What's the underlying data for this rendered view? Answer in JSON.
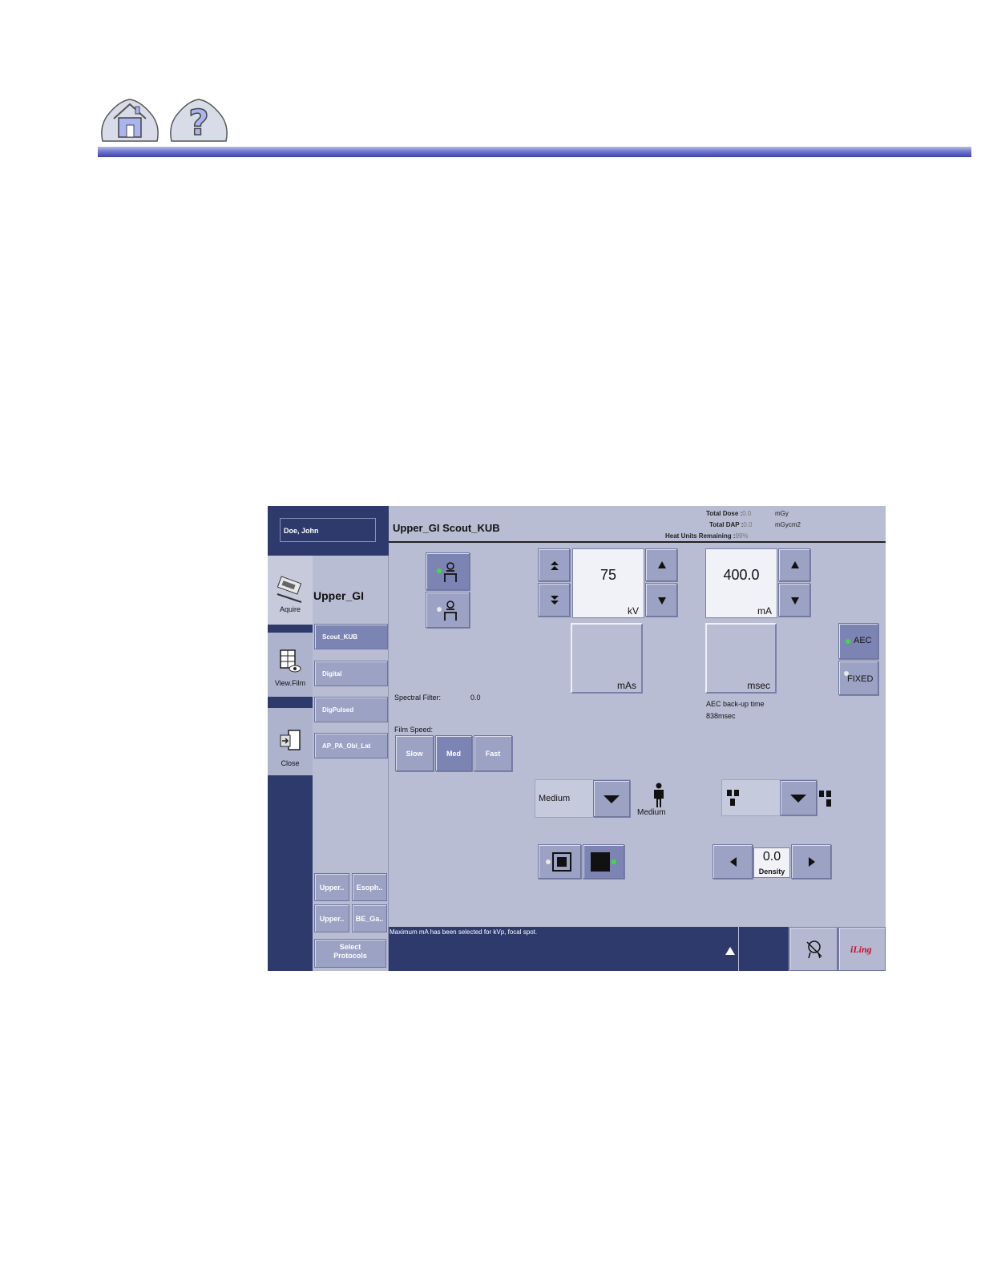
{
  "manual_nav": {
    "home_icon": "home-icon",
    "help_icon": "question-mark-icon"
  },
  "patient": {
    "name": "Doe, John"
  },
  "tabs": [
    {
      "label": "Aquire",
      "icon": "acquire-icon"
    },
    {
      "label": "View.Film",
      "icon": "view-film-icon"
    },
    {
      "label": "Close",
      "icon": "close-door-icon"
    }
  ],
  "protocol_group": "Upper_GI",
  "protocols": [
    "Scout_KUB",
    "Digital",
    "DigPulsed",
    "AP_PA_Obl_Lat"
  ],
  "quick_protocols": [
    "Upper..",
    "Esoph..",
    "Upper..",
    "BE_Ga.."
  ],
  "select_protocols": {
    "line1": "Select",
    "line2": "Protocols"
  },
  "header": {
    "title": "Upper_GI  Scout_KUB"
  },
  "dose": {
    "total_dose_label": "Total Dose :",
    "total_dose_value": "0.0",
    "total_dose_unit": "mGy",
    "total_dap_label": "Total DAP :",
    "total_dap_value": "0.0",
    "total_dap_unit": "mGycm2",
    "heat_label": "Heat Units Remaining :",
    "heat_value": "99%"
  },
  "technique": {
    "kv_value": "75",
    "kv_unit": "kV",
    "ma_value": "400.0",
    "ma_unit": "mA",
    "mas_unit": "mAs",
    "msec_unit": "msec",
    "aec_label": "AEC",
    "fixed_label": "FIXED",
    "aec_backup_label": "AEC back-up time",
    "aec_backup_value": "838msec"
  },
  "spectral_filter": {
    "label": "Spectral Filter:",
    "value": "0.0"
  },
  "film_speed": {
    "label": "Film Speed:",
    "options": [
      "Slow",
      "Med",
      "Fast"
    ],
    "selected": "Med"
  },
  "patient_size": {
    "selected": "Medium",
    "caption": "Medium"
  },
  "density": {
    "value": "0.0",
    "label": "Density"
  },
  "status_message": "Maximum mA has been selected for kVp, focal spot.",
  "brand": "iLing",
  "colors": {
    "navy": "#2e3a6b",
    "panel": "#b8bdd3",
    "button": "#9ca2c4",
    "led_green": "#3fdc3f",
    "brand_red": "#c8102e"
  }
}
